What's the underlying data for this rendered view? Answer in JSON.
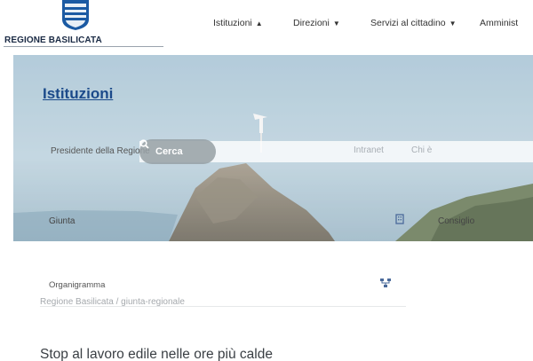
{
  "header": {
    "brand": "REGIONE BASILICATA",
    "nav": [
      {
        "label": "Istituzioni",
        "caret": "▲"
      },
      {
        "label": "Direzioni",
        "caret": "▼"
      },
      {
        "label": "Servizi al cittadino",
        "caret": "▼"
      },
      {
        "label": "Amminist",
        "caret": ""
      }
    ]
  },
  "hero": {
    "title": "Istituzioni",
    "search_label": "Cerca",
    "links": {
      "presidente": "Presidente della Regione",
      "intranet": "Intranet",
      "chi": "Chi è",
      "giunta": "Giunta",
      "consiglio": "Consiglio"
    }
  },
  "below": {
    "organigramma": "Organigramma",
    "breadcrumb": "Regione Basilicata / giunta-regionale",
    "article_title": "Stop al lavoro edile nelle ore più calde"
  },
  "colors": {
    "link_blue": "#1b4a8a",
    "icon_blue": "#4a6a9a",
    "search_pill": "#96a0a5"
  },
  "icons": [
    "region-crest-icon",
    "search-icon",
    "building-icon",
    "org-chart-icon"
  ]
}
